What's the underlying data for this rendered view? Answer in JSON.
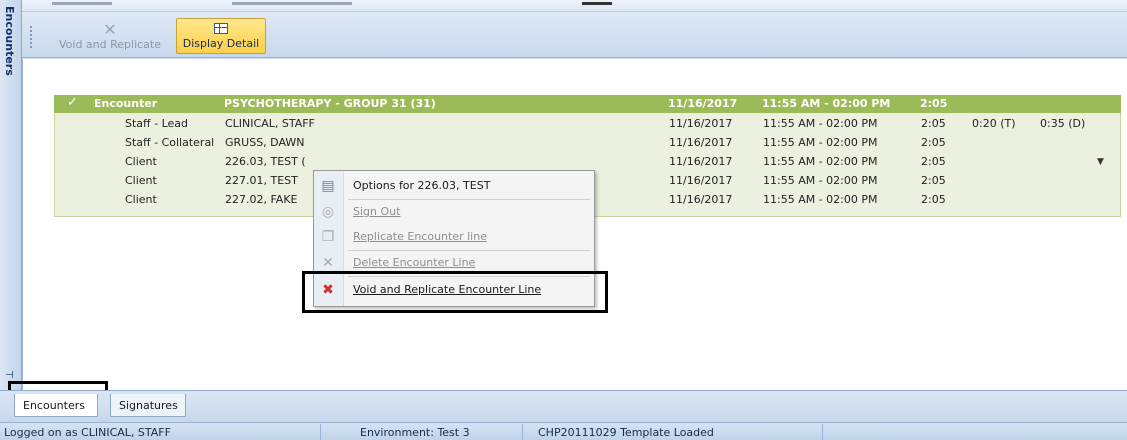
{
  "rail": {
    "label": "Encounters",
    "pin_icon": "pin-icon"
  },
  "toolbar": {
    "void_label": "Void and Replicate",
    "void_icon": "void-icon",
    "display_label": "Display Detail",
    "display_icon": "grid-icon"
  },
  "encounter": {
    "check": "✓",
    "type": "Encounter",
    "service": "PSYCHOTHERAPY -  GROUP 31 (31)",
    "date": "11/16/2017",
    "time": "11:55 AM - 02:00 PM",
    "duration": "2:05"
  },
  "lines": [
    {
      "role": "Staff - Lead",
      "name": "CLINICAL, STAFF",
      "date": "11/16/2017",
      "time": "11:55 AM - 02:00 PM",
      "duration": "2:05",
      "extra1": "0:20 (T)",
      "extra2": "0:35 (D)"
    },
    {
      "role": "Staff - Collateral",
      "name": "GRUSS, DAWN",
      "date": "11/16/2017",
      "time": "11:55 AM - 02:00 PM",
      "duration": "2:05",
      "extra1": "",
      "extra2": ""
    },
    {
      "role": "Client",
      "name": "226.03, TEST (",
      "date": "11/16/2017",
      "time": "11:55 AM - 02:00 PM",
      "duration": "2:05",
      "extra1": "",
      "extra2": ""
    },
    {
      "role": "Client",
      "name": "227.01, TEST",
      "date": "11/16/2017",
      "time": "11:55 AM - 02:00 PM",
      "duration": "2:05",
      "extra1": "",
      "extra2": ""
    },
    {
      "role": "Client",
      "name": "227.02, FAKE",
      "date": "11/16/2017",
      "time": "11:55 AM - 02:00 PM",
      "duration": "2:05",
      "extra1": "",
      "extra2": ""
    }
  ],
  "context_menu": {
    "items": [
      {
        "label": "Options for 226.03, TEST",
        "icon": "options-icon",
        "enabled": true
      },
      {
        "label": "Sign Out",
        "icon": "sign-out-icon",
        "enabled": false
      },
      {
        "label": "Replicate Encounter line",
        "icon": "replicate-icon",
        "enabled": false
      },
      {
        "label": "Delete Encounter Line",
        "icon": "delete-icon",
        "enabled": false
      },
      {
        "label": "Void and Replicate Encounter Line",
        "icon": "void-replicate-icon",
        "enabled": true
      }
    ]
  },
  "tabs": [
    {
      "label": "Encounters",
      "active": true
    },
    {
      "label": "Signatures",
      "active": false
    }
  ],
  "status": {
    "logged_on": "Logged on as CLINICAL, STAFF",
    "environment": "Environment: Test 3",
    "template": "CHP20111029 Template Loaded"
  },
  "colors": {
    "header_row": "#9bbb59",
    "detail_rows": "#ebf1de",
    "display_button": "#fbcf4a",
    "void_icon_red": "#d03030"
  }
}
